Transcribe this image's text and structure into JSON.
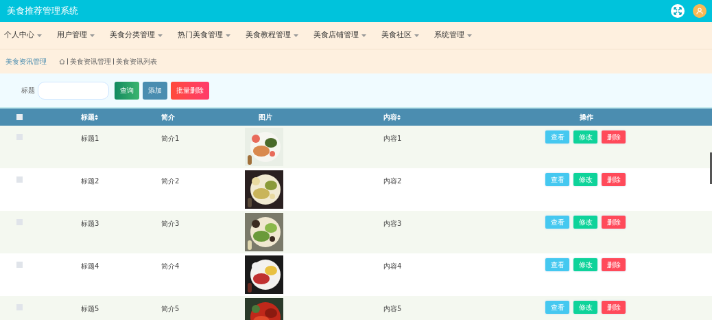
{
  "header": {
    "title": "美食推荐管理系统"
  },
  "nav": [
    {
      "label": "个人中心"
    },
    {
      "label": "用户管理"
    },
    {
      "label": "美食分类管理"
    },
    {
      "label": "热门美食管理"
    },
    {
      "label": "美食教程管理"
    },
    {
      "label": "美食店铺管理"
    },
    {
      "label": "美食社区"
    },
    {
      "label": "系统管理"
    }
  ],
  "breadcrumb": {
    "page": "美食资讯管理",
    "path": [
      "美食资讯管理",
      "美食资讯列表"
    ]
  },
  "search": {
    "label": "标题",
    "buttons": [
      {
        "kind": "search",
        "label": "查询"
      },
      {
        "kind": "add",
        "label": "添加"
      },
      {
        "kind": "delete",
        "label": "批量删除"
      }
    ]
  },
  "table": {
    "all_checked": false,
    "columns": [
      {
        "label": "标题",
        "sortable": true
      },
      {
        "label": "简介",
        "sortable": false
      },
      {
        "label": "图片",
        "sortable": false
      },
      {
        "label": "内容",
        "sortable": true
      },
      {
        "label": "操作",
        "sortable": false
      }
    ],
    "rows": [
      {
        "checked": false,
        "title": "标题1",
        "summary": "简介1",
        "content": "内容1",
        "actions": [
          {
            "kind": "view",
            "label": "查看"
          },
          {
            "kind": "edit",
            "label": "修改"
          },
          {
            "kind": "delete",
            "label": "删除"
          }
        ]
      },
      {
        "checked": false,
        "title": "标题2",
        "summary": "简介2",
        "content": "内容2",
        "actions": [
          {
            "kind": "view",
            "label": "查看"
          },
          {
            "kind": "edit",
            "label": "修改"
          },
          {
            "kind": "delete",
            "label": "删除"
          }
        ]
      },
      {
        "checked": false,
        "title": "标题3",
        "summary": "简介3",
        "content": "内容3",
        "actions": [
          {
            "kind": "view",
            "label": "查看"
          },
          {
            "kind": "edit",
            "label": "修改"
          },
          {
            "kind": "delete",
            "label": "删除"
          }
        ]
      },
      {
        "checked": false,
        "title": "标题4",
        "summary": "简介4",
        "content": "内容4",
        "actions": [
          {
            "kind": "view",
            "label": "查看"
          },
          {
            "kind": "edit",
            "label": "修改"
          },
          {
            "kind": "delete",
            "label": "删除"
          }
        ]
      },
      {
        "checked": false,
        "title": "标题5",
        "summary": "简介5",
        "content": "内容5",
        "actions": [
          {
            "kind": "view",
            "label": "查看"
          },
          {
            "kind": "edit",
            "label": "修改"
          },
          {
            "kind": "delete",
            "label": "删除"
          }
        ]
      }
    ]
  }
}
